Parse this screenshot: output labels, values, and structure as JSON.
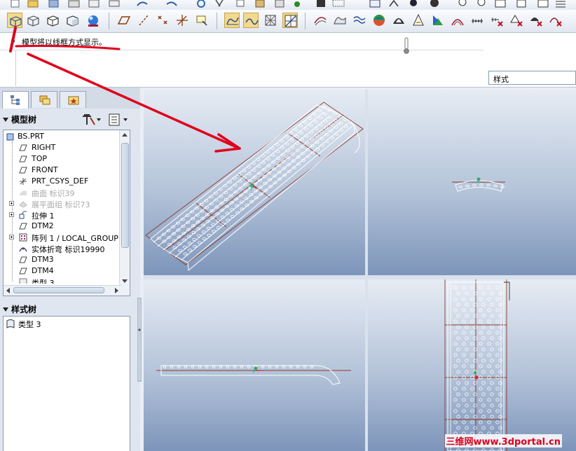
{
  "message": {
    "text": "模型将以线框方式显示。"
  },
  "style_selector": {
    "value": "样式"
  },
  "model_tree": {
    "title": "模型树",
    "items": [
      {
        "label": "BS.PRT",
        "icon": "part-icon"
      },
      {
        "label": "RIGHT",
        "icon": "datum-plane-icon"
      },
      {
        "label": "TOP",
        "icon": "datum-plane-icon"
      },
      {
        "label": "FRONT",
        "icon": "datum-plane-icon"
      },
      {
        "label": "PRT_CSYS_DEF",
        "icon": "csys-icon"
      },
      {
        "label": "曲面 标识39",
        "icon": "surface-icon",
        "suppressed": true
      },
      {
        "label": "展平面组 标识73",
        "icon": "flatten-quilt-icon",
        "suppressed": true
      },
      {
        "label": "拉伸 1",
        "icon": "extrude-icon"
      },
      {
        "label": "DTM2",
        "icon": "datum-plane-icon"
      },
      {
        "label": "阵列 1 / LOCAL_GROUP",
        "icon": "pattern-icon"
      },
      {
        "label": "实体折弯 标识19990",
        "icon": "toroidal-bend-icon"
      },
      {
        "label": "DTM3",
        "icon": "datum-plane-icon"
      },
      {
        "label": "DTM4",
        "icon": "datum-plane-icon"
      },
      {
        "label": "类型 3",
        "icon": "feature-icon"
      }
    ]
  },
  "style_tree": {
    "title": "样式树",
    "items": [
      {
        "label": "类型 3",
        "icon": "style-icon"
      }
    ]
  },
  "toolbar": {
    "main_icons": [
      "wireframe-display-icon",
      "hidden-line-icon",
      "no-hidden-icon",
      "shading-icon",
      "appearance-ball-icon",
      "datum-plane-toggle-icon",
      "datum-axis-toggle-icon",
      "datum-point-toggle-icon",
      "csys-toggle-icon",
      "spin-center-icon",
      "surface-icon",
      "curve-icon",
      "sketch-icon",
      "grid-icon",
      "blend-surface-icon",
      "free-surface-icon",
      "curve-edit-icon",
      "reflection-icon",
      "draft-analysis-icon",
      "slope-icon",
      "section-icon",
      "curvature-icon",
      "measure-icon",
      "delete-analysis-icon",
      "delete-shading-icon",
      "delete-curve-icon",
      "delete-all-icon"
    ],
    "top_icons": [
      "new-icon",
      "open-icon",
      "save-icon",
      "print-icon",
      "email-icon",
      "undo-icon",
      "redo-icon",
      "regenerate-icon",
      "cut-icon",
      "copy-icon",
      "paste-icon",
      "find-icon",
      "select-box-icon",
      "repaint-icon",
      "orient-icon",
      "appearance-icon",
      "zoom-in-icon",
      "zoom-out-icon",
      "refit-icon",
      "view-manager-icon",
      "layer-icon"
    ]
  },
  "navigator": {
    "tabs": [
      "model-tree-tab-icon",
      "folder-browser-tab-icon",
      "favorites-tab-icon"
    ]
  },
  "watermark": {
    "text": "三维网www.3dportal.cn"
  },
  "colors": {
    "annotation_red": "#e0001b",
    "model_edge": "#ffffff",
    "datum_line": "#8b3a2a",
    "viewport_top": "#e6ecf4",
    "viewport_bottom": "#7d95ba",
    "toolbar_pressed": "#f3d98d"
  }
}
